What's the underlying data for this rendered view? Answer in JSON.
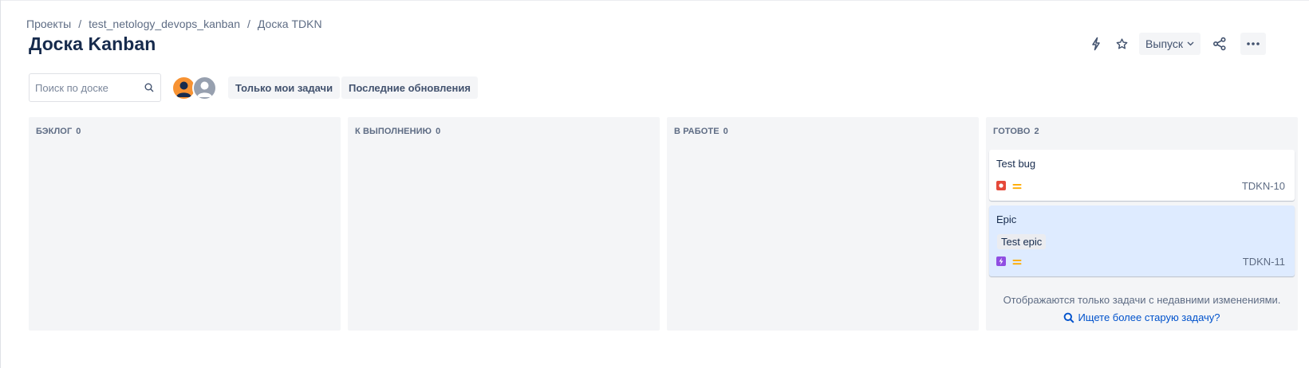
{
  "breadcrumb": {
    "items": [
      "Проекты",
      "test_netology_devops_kanban",
      "Доска TDKN"
    ],
    "separator": "/"
  },
  "page_title": "Доска Kanban",
  "header_actions": {
    "automation_icon": "lightning-icon",
    "star_icon": "star-icon",
    "release_label": "Выпуск",
    "share_icon": "share-icon",
    "more_icon": "more-icon"
  },
  "search": {
    "placeholder": "Поиск по доске",
    "value": ""
  },
  "avatars": [
    {
      "name": "user-avatar-1",
      "color": "#f79232"
    },
    {
      "name": "user-avatar-2",
      "color": "#97a0af"
    }
  ],
  "filters": {
    "only_my_issues": "Только мои задачи",
    "recently_updated": "Последние обновления"
  },
  "columns": [
    {
      "title": "БЭКЛОГ",
      "count": "0"
    },
    {
      "title": "К ВЫПОЛНЕНИЮ",
      "count": "0"
    },
    {
      "title": "В РАБОТЕ",
      "count": "0"
    },
    {
      "title": "ГОТОВО",
      "count": "2"
    }
  ],
  "cards": [
    {
      "summary": "Test bug",
      "key": "TDKN-10",
      "type": "bug",
      "type_color": "#e5493a",
      "priority": "medium",
      "priority_color": "#ffab00",
      "epic": "",
      "background": "#ffffff"
    },
    {
      "summary": "Epic",
      "key": "TDKN-11",
      "type": "epic",
      "type_color": "#904ee2",
      "priority": "medium",
      "priority_color": "#ffab00",
      "epic": "Test epic",
      "background": "#deebff"
    }
  ],
  "done_footer": {
    "note": "Отображаются только задачи с недавними изменениями.",
    "link": "Ищете более старую задачу?"
  },
  "colors": {
    "link": "#0052cc",
    "column_bg": "#f4f5f7",
    "text": "#172b4d"
  }
}
